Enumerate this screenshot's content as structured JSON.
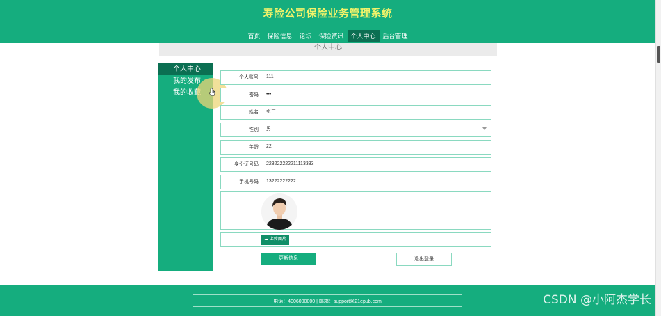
{
  "header": {
    "title": "寿险公司保险业务管理系统",
    "nav": [
      "首页",
      "保险信息",
      "论坛",
      "保险资讯",
      "个人中心",
      "后台管理"
    ],
    "active_nav_index": 4
  },
  "section_title": "个人中心",
  "sidebar": {
    "items": [
      "个人中心",
      "我的发布",
      "我的收藏"
    ],
    "active_index": 0
  },
  "form": {
    "fields": [
      {
        "label": "个人账号",
        "value": "111"
      },
      {
        "label": "密码",
        "value": "•••"
      },
      {
        "label": "姓名",
        "value": "张三"
      },
      {
        "label": "性别",
        "value": "男"
      },
      {
        "label": "年龄",
        "value": "22"
      },
      {
        "label": "身份证号码",
        "value": "223222222211113333"
      },
      {
        "label": "手机号码",
        "value": "13222222222"
      }
    ],
    "upload_label": "上传图片",
    "update_label": "更新信息",
    "logout_label": "退出登录"
  },
  "footer": {
    "contact": "电话：4006000000 | 邮箱：support@21epub.com"
  },
  "watermark": "CSDN @小阿杰学长",
  "colors": {
    "primary": "#15ad7e",
    "primary_dark": "#0b6f52",
    "title_yellow": "#f3f36a"
  }
}
